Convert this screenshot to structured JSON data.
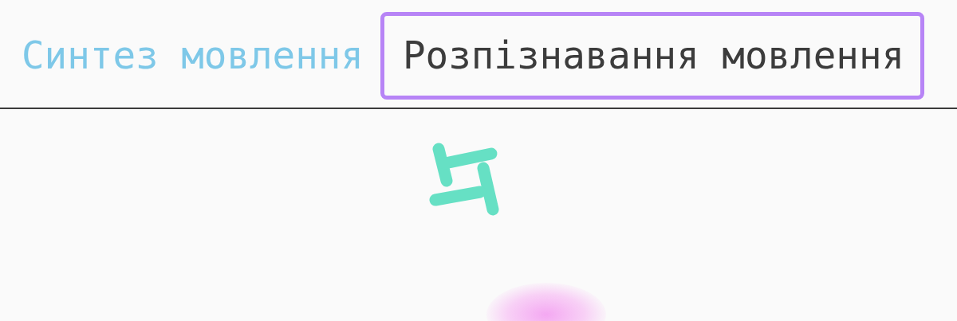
{
  "tabs": [
    {
      "label": "Синтез мовлення",
      "selected": false
    },
    {
      "label": "Розпізнавання мовлення",
      "selected": true
    }
  ]
}
